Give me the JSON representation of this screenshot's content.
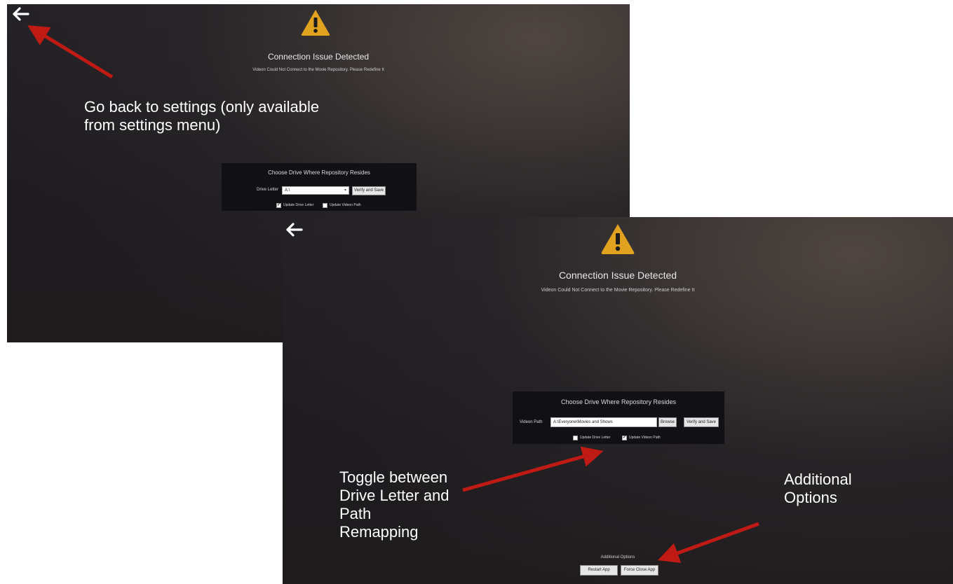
{
  "screen1": {
    "title": "Connection Issue Detected",
    "subtitle": "Videon Could Not Connect to the Movie Repository. Please Redefine It",
    "panel": {
      "heading": "Choose Drive Where Repository Resides",
      "field_label": "Drive Letter",
      "field_value": "A:\\",
      "verify_button": "Verify and Save",
      "checkbox_drive": "Update Drive Letter",
      "checkbox_path": "Update Videon Path",
      "drive_checked": true,
      "path_checked": false
    }
  },
  "screen2": {
    "title": "Connection Issue Detected",
    "subtitle": "Videon Could Not Connect to the Movie Repository. Please Redefine It",
    "panel": {
      "heading": "Choose Drive Where Repository Resides",
      "field_label": "Videon Path",
      "field_value": "A:\\Everyone\\Movies and Shows",
      "browse_button": "Browse",
      "verify_button": "Verify and Save",
      "checkbox_drive": "Update Drive Letter",
      "checkbox_path": "Update Videon Path",
      "drive_checked": false,
      "path_checked": true
    },
    "additional": {
      "heading": "Additional Options",
      "restart_button": "Restart App",
      "force_close_button": "Force Close App"
    }
  },
  "annotations": {
    "back": "Go back to settings (only available from settings menu)",
    "toggle": "Toggle between Drive Letter and Path Remapping",
    "additional": "Additional Options"
  },
  "colors": {
    "warning": "#e0a21f",
    "arrow": "#c01a14"
  }
}
